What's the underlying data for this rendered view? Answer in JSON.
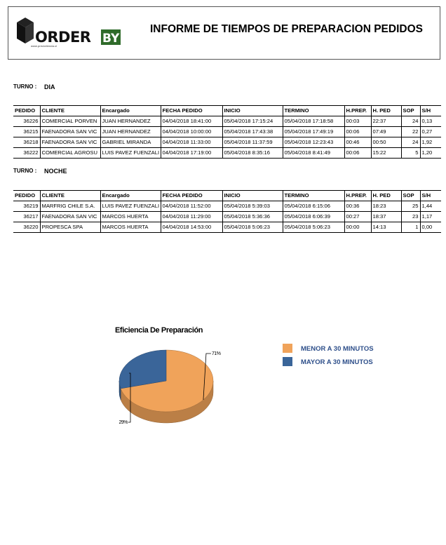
{
  "header": {
    "logo_text_a": "ORDER",
    "logo_text_b": "BY",
    "logo_tagline": "www.preciotienda.cl",
    "title": "INFORME DE TIEMPOS DE PREPARACION PEDIDOS"
  },
  "columns": [
    "PEDIDO",
    "CLIENTE",
    "Encargado",
    "FECHA PEDIDO",
    "INICIO",
    "TERMINO",
    "H.PREP.",
    "H. PED",
    "SOP",
    "S/H"
  ],
  "shifts": [
    {
      "label": "TURNO :",
      "value": "DIA",
      "rows": [
        [
          "36226",
          "COMERCIAL PORVEN",
          "JUAN HERNANDEZ",
          "04/04/2018  18:41:00",
          "05/04/2018  17:15:24",
          "05/04/2018  17:18:58",
          "00:03",
          "22:37",
          "24",
          "0,13"
        ],
        [
          "36215",
          "FAENADORA SAN VIC",
          "JUAN HERNANDEZ",
          "04/04/2018  10:00:00",
          "05/04/2018  17:43:38",
          "05/04/2018  17:49:19",
          "00:06",
          "07:49",
          "22",
          "0,27"
        ],
        [
          "36218",
          "FAENADORA SAN VIC",
          "GABRIEL   MIRANDA",
          "04/04/2018  11:33:00",
          "05/04/2018  11:37:59",
          "05/04/2018  12:23:43",
          "00:46",
          "00:50",
          "24",
          "1,92"
        ],
        [
          "36222",
          "COMERCIAL AGROSU",
          "LUIS PAVEZ FUENZALI",
          "04/04/2018  17:19:00",
          "05/04/2018   8:35:16",
          "05/04/2018   8:41:49",
          "00:06",
          "15:22",
          "5",
          "1,20"
        ]
      ]
    },
    {
      "label": "TURNO :",
      "value": "NOCHE",
      "rows": [
        [
          "36219",
          "MARFRIG CHILE S.A.",
          "LUIS PAVEZ FUENZALI",
          "04/04/2018  11:52:00",
          "05/04/2018   5:39:03",
          "05/04/2018   6:15:06",
          "00:36",
          "18:23",
          "25",
          "1,44"
        ],
        [
          "36217",
          "FAENADORA SAN VIC",
          "MARCOS HUERTA",
          "04/04/2018  11:29:00",
          "05/04/2018   5:36:36",
          "05/04/2018   6:06:39",
          "00:27",
          "18:37",
          "23",
          "1,17"
        ],
        [
          "36220",
          "PROPESCA SPA",
          "MARCOS HUERTA",
          "04/04/2018  14:53:00",
          "05/04/2018   5:06:23",
          "05/04/2018   5:06:23",
          "00:00",
          "14:13",
          "1",
          "0,00"
        ]
      ]
    }
  ],
  "chart_data": {
    "type": "pie",
    "title": "Eficiencia De Preparación",
    "slices": [
      {
        "name": "MENOR A 30  MINUTOS",
        "value": 71,
        "label": "71%",
        "color": "#f0a35a"
      },
      {
        "name": "MAYOR A 30  MINUTOS",
        "value": 29,
        "label": "29%",
        "color": "#3a6599"
      }
    ],
    "legend_position": "right"
  }
}
